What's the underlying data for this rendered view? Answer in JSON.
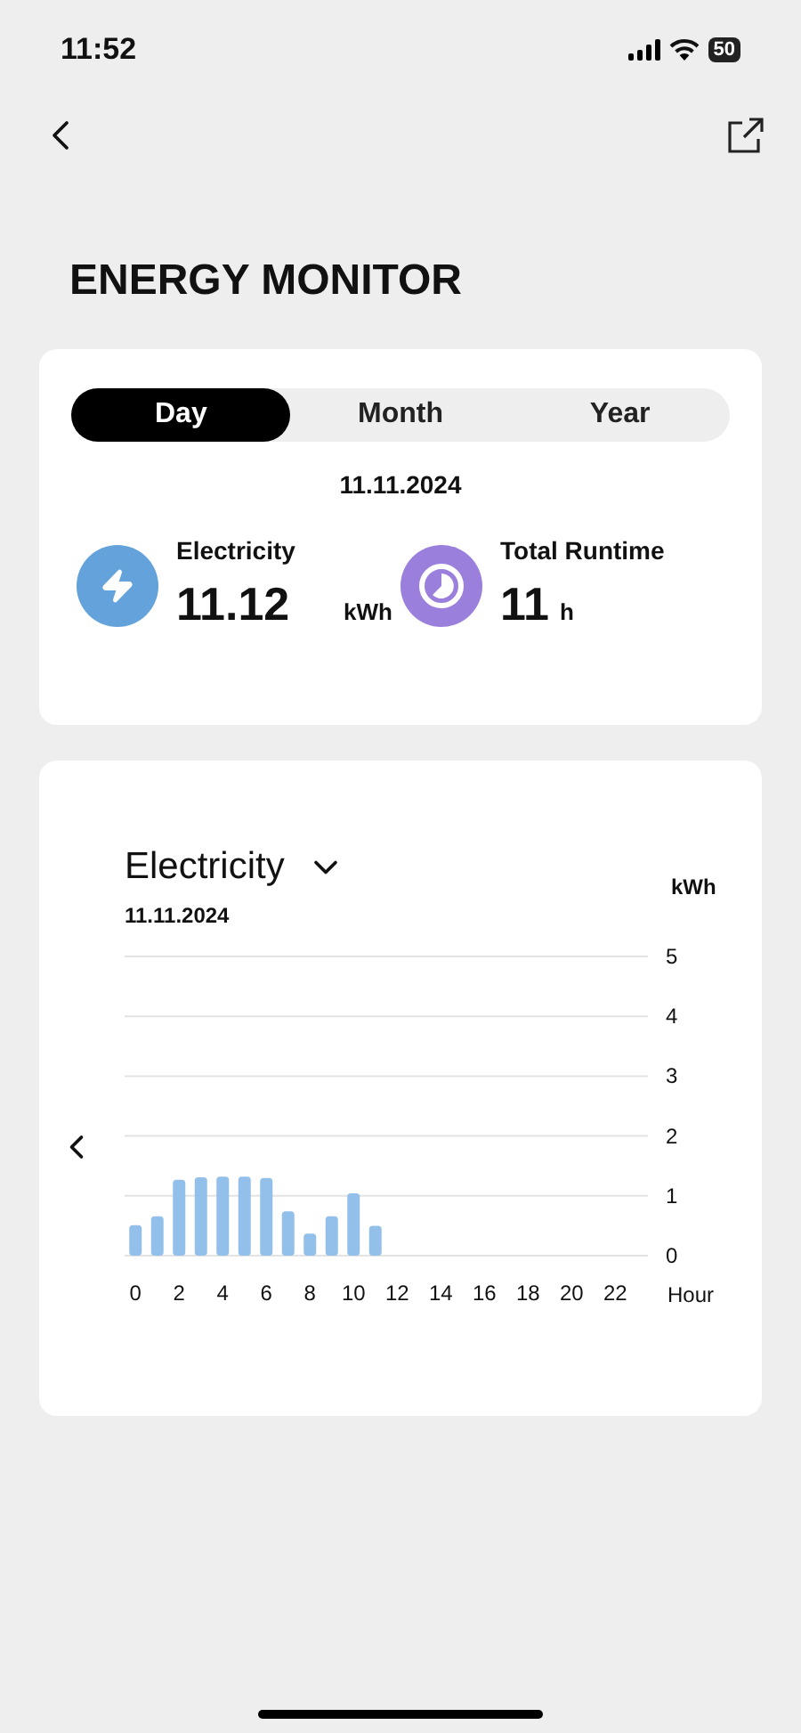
{
  "status_bar": {
    "time": "11:52",
    "battery": "50"
  },
  "title": "ENERGY MONITOR",
  "tabs": [
    {
      "label": "Day",
      "selected": true
    },
    {
      "label": "Month",
      "selected": false
    },
    {
      "label": "Year",
      "selected": false
    }
  ],
  "summary": {
    "date": "11.11.2024",
    "stats": [
      {
        "kind": "electricity",
        "label": "Electricity",
        "value": "11.12",
        "unit": "kWh"
      },
      {
        "kind": "runtime",
        "label": "Total Runtime",
        "value": "11",
        "unit": "h"
      }
    ]
  },
  "chart_card": {
    "metric": "Electricity",
    "date": "11.11.2024",
    "chart_data": {
      "type": "bar",
      "xlabel": "Hour",
      "ylabel": "kWh",
      "x": [
        0,
        1,
        2,
        3,
        4,
        5,
        6,
        7,
        8,
        9,
        10,
        11
      ],
      "series": [
        {
          "color": "#93c0ea",
          "values": [
            0.51,
            0.66,
            1.27,
            1.31,
            1.32,
            1.32,
            1.3,
            0.74,
            0.37,
            0.66,
            1.04,
            0.5
          ]
        }
      ],
      "xlim": [
        -0.5,
        23.5
      ],
      "ylim": [
        0,
        5
      ],
      "grid": true,
      "xticks": [
        0,
        2,
        4,
        6,
        8,
        10,
        12,
        14,
        16,
        18,
        20,
        22
      ],
      "yticks": [
        0,
        1,
        2,
        3,
        4,
        5
      ]
    }
  }
}
